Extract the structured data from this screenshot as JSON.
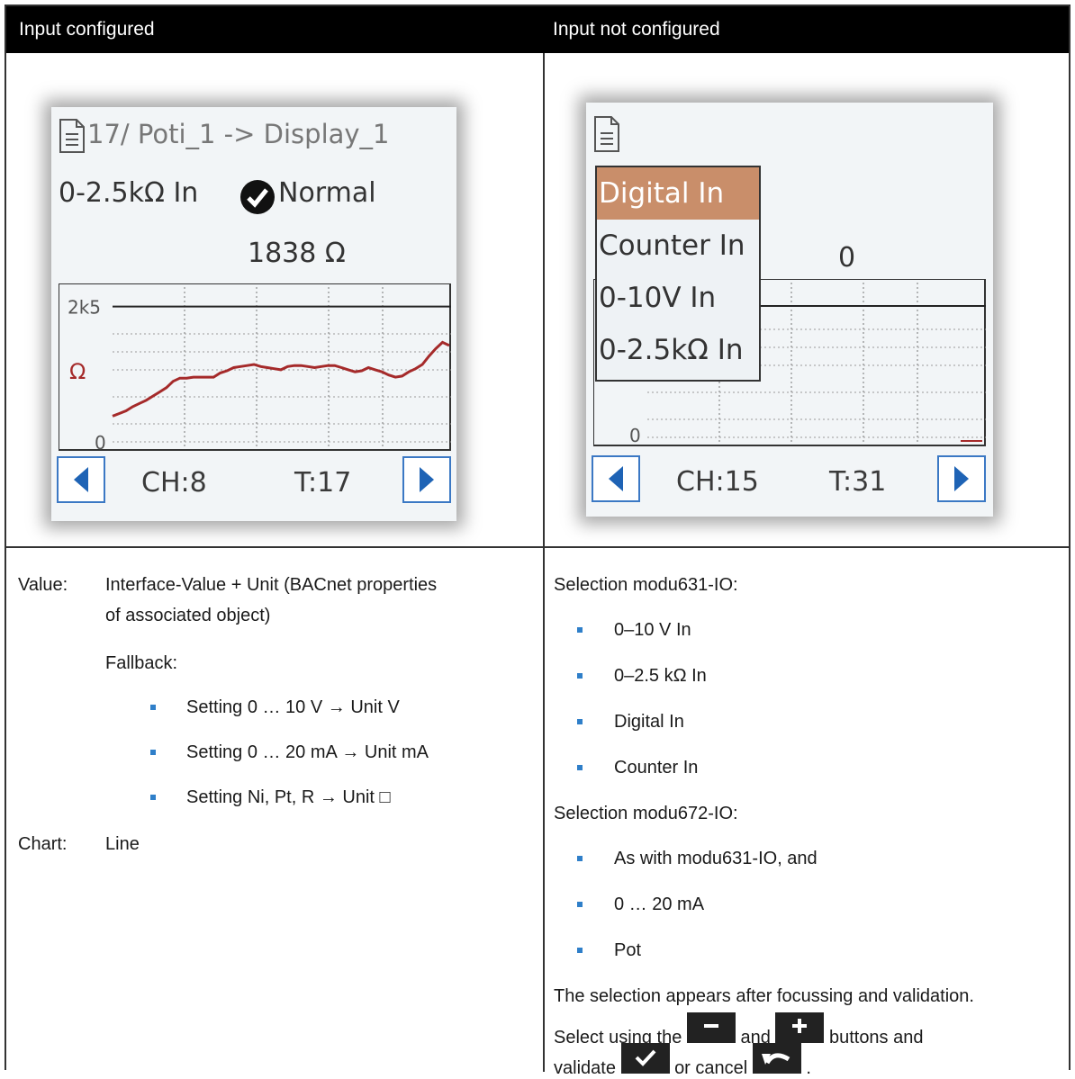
{
  "header": {
    "left_title": "Input configured",
    "right_title": "Input not configured"
  },
  "left_screen": {
    "title": "17/ Poti_1 -> Display_1",
    "mode": "0-2.5kΩ In",
    "status": "Normal",
    "value": "1838  Ω",
    "chart_data": {
      "type": "line",
      "ytick_labels": [
        "2k5",
        "0"
      ],
      "ylabel": "Ω",
      "series_color": "#a52a2a",
      "reference_line": 2500,
      "ylim": [
        0,
        2800
      ],
      "x": [
        0,
        1,
        2,
        3,
        4,
        5,
        6,
        7,
        8,
        9,
        10,
        11,
        12,
        13,
        14,
        15,
        16,
        17,
        18,
        19,
        20,
        21,
        22,
        23,
        24,
        25,
        26,
        27,
        28,
        29,
        30,
        31,
        32,
        33,
        34,
        35,
        36,
        37,
        38,
        39,
        40,
        41,
        42,
        43,
        44,
        45,
        46,
        47,
        48,
        49,
        50
      ],
      "values": [
        420,
        470,
        520,
        600,
        660,
        720,
        800,
        880,
        960,
        1080,
        1140,
        1140,
        1160,
        1160,
        1160,
        1160,
        1240,
        1280,
        1340,
        1360,
        1380,
        1400,
        1360,
        1340,
        1320,
        1300,
        1360,
        1380,
        1380,
        1360,
        1340,
        1360,
        1380,
        1380,
        1340,
        1300,
        1260,
        1280,
        1340,
        1300,
        1260,
        1200,
        1160,
        1180,
        1260,
        1320,
        1400,
        1560,
        1700,
        1820,
        1760
      ]
    },
    "footer": {
      "ch": "CH:8",
      "t": "T:17"
    }
  },
  "right_screen": {
    "menu": [
      "Digital In",
      "Counter In",
      "0-10V In",
      "0-2.5kΩ In"
    ],
    "selected_index": 0,
    "value": "0",
    "ytick_label": "0",
    "footer": {
      "ch": "CH:15",
      "t": "T:31"
    }
  },
  "left_text": {
    "value_label": "Value:",
    "value_desc_1": "Interface-Value + Unit (BACnet properties",
    "value_desc_2": "of associated object)",
    "fallback": "Fallback:",
    "bullets": [
      "Setting 0 … 10 V → Unit V",
      "Setting 0 … 20 mA → Unit mA",
      "Setting Ni, Pt, R → Unit □"
    ],
    "chart_label": "Chart:",
    "chart_value": "Line"
  },
  "right_text": {
    "selection_631": "Selection modu631-IO:",
    "bullets_631": [
      "0–10 V In",
      "0–2.5 kΩ In",
      "Digital In",
      "Counter In"
    ],
    "selection_672": "Selection modu672-IO:",
    "bullets_672": [
      "As with modu631-IO, and",
      "0 … 20 mA",
      "Pot"
    ],
    "para_line1": "The selection appears after focussing and validation.",
    "para_line2_a": "Select using the",
    "para_line2_b": "and",
    "para_line2_c": "buttons and",
    "para_line3_a": "validate",
    "para_line3_b": "or cancel",
    "para_line3_c": "."
  },
  "colors": {
    "accent": "#3b78c4",
    "selection": "#c98e6a",
    "trace": "#a52a2a"
  },
  "icons": [
    "document-icon",
    "check-circle-icon",
    "arrow-left-icon",
    "arrow-right-icon",
    "minus-icon",
    "plus-icon",
    "checkmark-icon",
    "undo-icon"
  ]
}
